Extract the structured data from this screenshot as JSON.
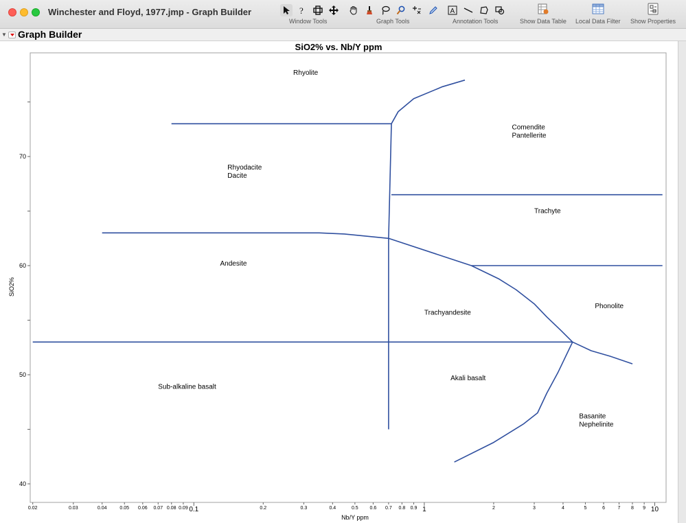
{
  "window": {
    "title": "Winchester and Floyd, 1977.jmp - Graph Builder"
  },
  "toolbar": {
    "groups": [
      {
        "label": "Window Tools",
        "icons": [
          "arrow-pointer-icon",
          "help-question-icon",
          "selection-crosshair-icon",
          "move-cross-icon"
        ]
      },
      {
        "label": "Graph Tools",
        "icons": [
          "hand-grabber-icon",
          "brush-icon",
          "lasso-icon",
          "magnifier-icon",
          "crosshair-icon"
        ]
      },
      {
        "label": "Annotation Tools",
        "icons": [
          "pencil-icon",
          "text-annotation-icon",
          "line-icon",
          "polygon-icon",
          "simple-shape-icon"
        ]
      }
    ],
    "buttons": [
      {
        "label": "Show Data Table",
        "icon": "data-table-icon"
      },
      {
        "label": "Local Data Filter",
        "icon": "data-filter-icon"
      },
      {
        "label": "Show Properties",
        "icon": "properties-icon"
      }
    ]
  },
  "outline": {
    "title": "Graph Builder"
  },
  "colors": {
    "line": "#2f4f9f",
    "frame": "#a0a0a0"
  },
  "chart_data": {
    "type": "line",
    "title": "SiO2% vs. Nb/Y ppm",
    "xlabel": "Nb/Y ppm",
    "ylabel": "SiO2%",
    "xscale": "log",
    "xlim": [
      0.0195,
      11.2
    ],
    "ylim": [
      38.3,
      79.5
    ],
    "xticks": [
      {
        "value": 0.02,
        "label": "0.02",
        "major": false
      },
      {
        "value": 0.03,
        "label": "0.03",
        "major": false
      },
      {
        "value": 0.04,
        "label": "0.04",
        "major": false
      },
      {
        "value": 0.05,
        "label": "0.05",
        "major": false
      },
      {
        "value": 0.06,
        "label": "0.06",
        "major": false
      },
      {
        "value": 0.07,
        "label": "0.07",
        "major": false
      },
      {
        "value": 0.08,
        "label": "0.08",
        "major": false
      },
      {
        "value": 0.09,
        "label": "0.09",
        "major": false
      },
      {
        "value": 0.1,
        "label": "0.1",
        "major": true
      },
      {
        "value": 0.2,
        "label": "0.2",
        "major": false
      },
      {
        "value": 0.3,
        "label": "0.3",
        "major": false
      },
      {
        "value": 0.4,
        "label": "0.4",
        "major": false
      },
      {
        "value": 0.5,
        "label": "0.5",
        "major": false
      },
      {
        "value": 0.6,
        "label": "0.6",
        "major": false
      },
      {
        "value": 0.7,
        "label": "0.7",
        "major": false
      },
      {
        "value": 0.8,
        "label": "0.8",
        "major": false
      },
      {
        "value": 0.9,
        "label": "0.9",
        "major": false
      },
      {
        "value": 1,
        "label": "1",
        "major": true
      },
      {
        "value": 2,
        "label": "2",
        "major": false
      },
      {
        "value": 3,
        "label": "3",
        "major": false
      },
      {
        "value": 4,
        "label": "4",
        "major": false
      },
      {
        "value": 5,
        "label": "5",
        "major": false
      },
      {
        "value": 6,
        "label": "6",
        "major": false
      },
      {
        "value": 7,
        "label": "7",
        "major": false
      },
      {
        "value": 8,
        "label": "8",
        "major": false
      },
      {
        "value": 9,
        "label": "9",
        "major": false
      },
      {
        "value": 10,
        "label": "10",
        "major": true
      }
    ],
    "yticks": [
      {
        "value": 40,
        "label": "40"
      },
      {
        "value": 45,
        "label": ""
      },
      {
        "value": 50,
        "label": "50"
      },
      {
        "value": 55,
        "label": ""
      },
      {
        "value": 60,
        "label": "60"
      },
      {
        "value": 65,
        "label": ""
      },
      {
        "value": 70,
        "label": "70"
      },
      {
        "value": 75,
        "label": ""
      }
    ],
    "boundaries": [
      {
        "points": [
          [
            0.08,
            73
          ],
          [
            0.72,
            73
          ],
          [
            0.77,
            74.1
          ],
          [
            0.9,
            75.3
          ],
          [
            1.2,
            76.4
          ],
          [
            1.5,
            77
          ]
        ]
      },
      {
        "points": [
          [
            0.72,
            73
          ],
          [
            0.7,
            62.5
          ],
          [
            0.7,
            45
          ]
        ]
      },
      {
        "points": [
          [
            0.72,
            66.5
          ],
          [
            10.8,
            66.5
          ]
        ]
      },
      {
        "points": [
          [
            0.04,
            63
          ],
          [
            0.35,
            63
          ],
          [
            0.45,
            62.9
          ],
          [
            0.7,
            62.5
          ],
          [
            1.6,
            60
          ]
        ]
      },
      {
        "points": [
          [
            1.6,
            60
          ],
          [
            10.8,
            60
          ]
        ]
      },
      {
        "points": [
          [
            1.6,
            60
          ],
          [
            2.1,
            58.8
          ],
          [
            2.5,
            57.8
          ],
          [
            3.0,
            56.5
          ],
          [
            3.4,
            55.3
          ],
          [
            3.9,
            54.1
          ],
          [
            4.4,
            53
          ]
        ]
      },
      {
        "points": [
          [
            0.02,
            53
          ],
          [
            4.4,
            53
          ]
        ]
      },
      {
        "points": [
          [
            4.4,
            53
          ],
          [
            5.3,
            52.2
          ],
          [
            6.4,
            51.7
          ],
          [
            8,
            51
          ]
        ]
      },
      {
        "points": [
          [
            4.4,
            53
          ],
          [
            3.8,
            50.2
          ],
          [
            3.4,
            48.3
          ],
          [
            3.1,
            46.5
          ],
          [
            2.7,
            45.5
          ],
          [
            2.0,
            43.8
          ],
          [
            1.35,
            42
          ]
        ]
      }
    ],
    "annotations": [
      {
        "lines": [
          "Rhyolite"
        ],
        "x": 0.27,
        "y": 77.5
      },
      {
        "lines": [
          "Comendite",
          "Pantellerite"
        ],
        "x": 2.4,
        "y": 72.5
      },
      {
        "lines": [
          "Rhyodacite",
          "Dacite"
        ],
        "x": 0.14,
        "y": 68.8
      },
      {
        "lines": [
          "Trachyte"
        ],
        "x": 3.0,
        "y": 64.8
      },
      {
        "lines": [
          "Andesite"
        ],
        "x": 0.13,
        "y": 60
      },
      {
        "lines": [
          "Phonolite"
        ],
        "x": 5.5,
        "y": 56.1
      },
      {
        "lines": [
          "Trachyandesite"
        ],
        "x": 1.0,
        "y": 55.5
      },
      {
        "lines": [
          "Akali basalt"
        ],
        "x": 1.3,
        "y": 49.5
      },
      {
        "lines": [
          "Sub-alkaline basalt"
        ],
        "x": 0.07,
        "y": 48.7
      },
      {
        "lines": [
          "Basanite",
          "Nephelinite"
        ],
        "x": 4.7,
        "y": 46
      }
    ]
  }
}
